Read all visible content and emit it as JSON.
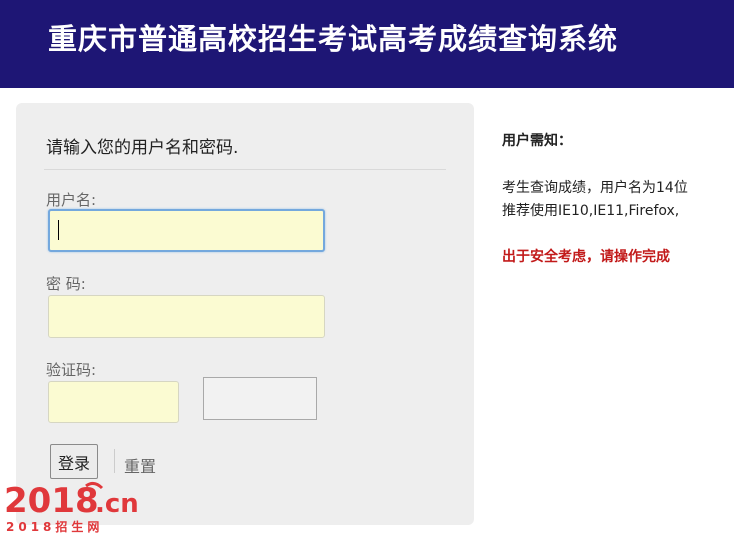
{
  "header": {
    "title": "重庆市普通高校招生考试高考成绩查询系统"
  },
  "login": {
    "heading": "请输入您的用户名和密码.",
    "username_label": "用户名:",
    "username_value": "",
    "password_label": "密 码:",
    "password_value": "",
    "captcha_label": "验证码:",
    "captcha_value": "",
    "submit_label": "登录",
    "reset_label": "重置"
  },
  "notice": {
    "title": "用户需知：",
    "line1": "考生查询成绩，用户名为14位",
    "line2": "推荐使用IE10,IE11,Firefox,",
    "warning": "出于安全考虑，请操作完成"
  },
  "watermark": {
    "main": "2018",
    "suffix": ".cn",
    "sub": "2018招生网"
  },
  "colors": {
    "header_bg": "#1e1675",
    "panel_bg": "#eeeeee",
    "input_bg": "#fbfbd2",
    "focus_border": "#74a8dd",
    "warning": "#c21a1a",
    "watermark": "#e0383b"
  },
  "icons": {
    "watermark_logo": "logo-2018-icon"
  }
}
